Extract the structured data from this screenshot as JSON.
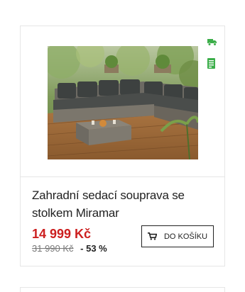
{
  "product": {
    "title": "Zahradní sedací souprava se stolkem Miramar",
    "price": "14 999 Kč",
    "old_price": "31 990 Kč",
    "discount": "- 53 %",
    "image_icon": "garden-sofa-photo"
  },
  "badges": {
    "delivery_icon": "delivery-truck-icon",
    "stock_icon": "stock-list-icon",
    "color": "#3cae4a"
  },
  "cart_button": {
    "label": "DO KOŠÍKU",
    "icon": "cart-icon"
  },
  "colors": {
    "price": "#cc1f1f",
    "border": "#e6e6e6",
    "text": "#222222"
  }
}
